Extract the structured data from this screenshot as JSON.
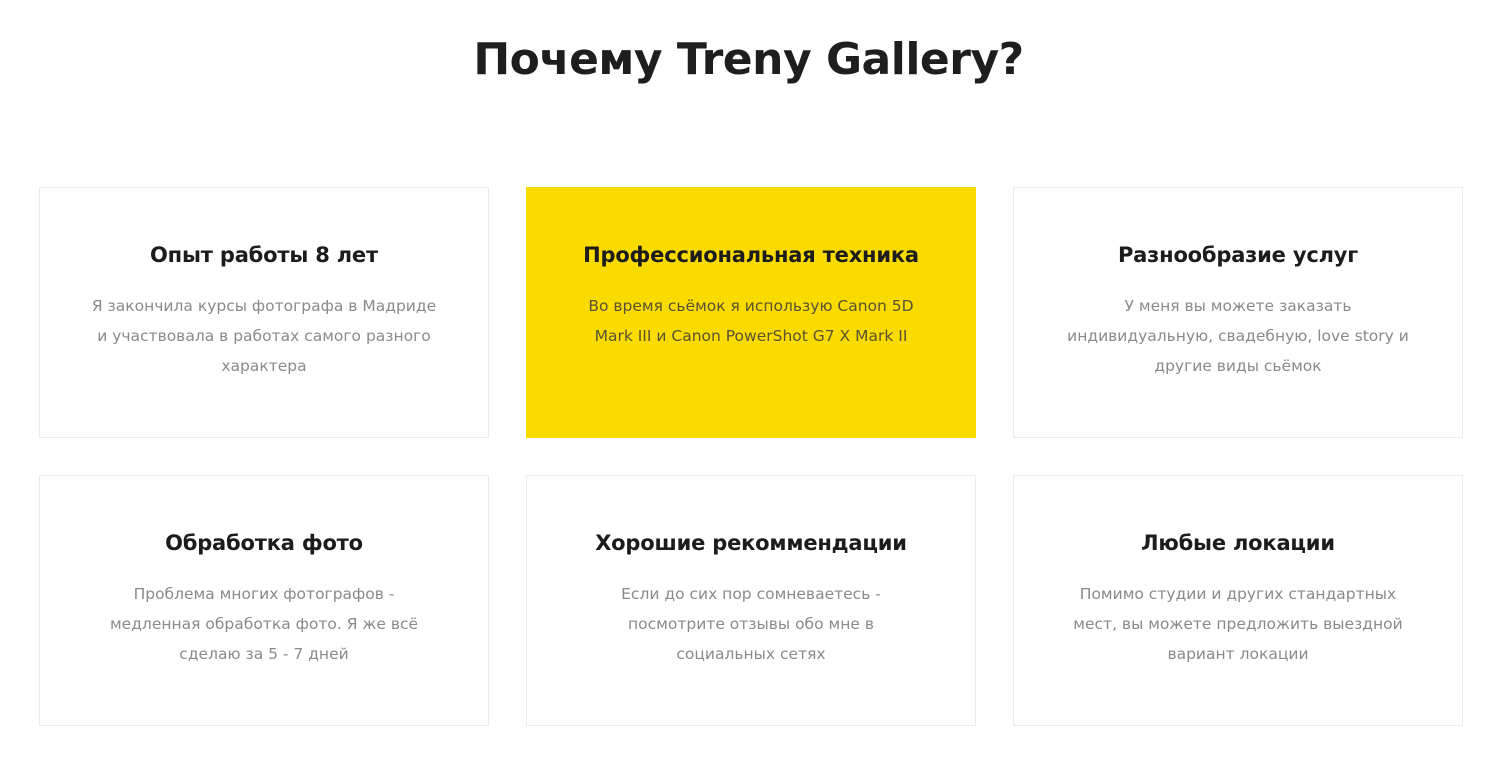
{
  "section": {
    "title": "Почему Treny Gallery?"
  },
  "features": [
    {
      "title": "Опыт работы 8 лет",
      "text": "Я закончила курсы фотографа в Мадриде и участвовала в работах самого разного характера",
      "highlighted": false
    },
    {
      "title": "Профессиональная техника",
      "text": "Во время сьёмок я использую Canon 5D Mark III и Canon PowerShot G7 X Mark II",
      "highlighted": true
    },
    {
      "title": "Разнообразие услуг",
      "text": "У меня вы можете заказать индивидуальную, свадебную, love story и другие виды сьёмок",
      "highlighted": false
    },
    {
      "title": "Обработка фото",
      "text": "Проблема многих фотографов - медленная обработка фото. Я же всё сделаю за 5 - 7 дней",
      "highlighted": false
    },
    {
      "title": "Хорошие рекоммендации",
      "text": "Если до сих пор сомневаетесь - посмотрите отзывы обо мне в социальных сетях",
      "highlighted": false
    },
    {
      "title": "Любые локации",
      "text": "Помимо студии и других стандартных мест, вы можете предложить выездной вариант локации",
      "highlighted": false
    }
  ],
  "colors": {
    "accent": "#fadb00",
    "title_text": "#1c1c1c",
    "body_text": "#8a8a8a",
    "card_border": "#ececec"
  }
}
